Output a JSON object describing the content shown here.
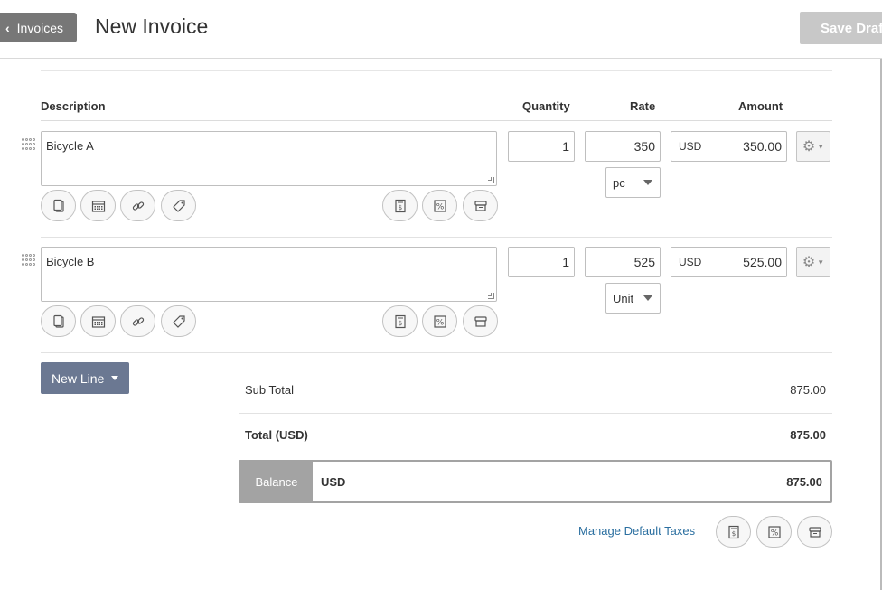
{
  "header": {
    "back_label": "Invoices",
    "title": "New Invoice",
    "save_label": "Save Draft"
  },
  "table": {
    "columns": [
      "Description",
      "Quantity",
      "Rate",
      "Amount"
    ],
    "rows": [
      {
        "description": "Bicycle A",
        "quantity": "1",
        "rate": "350",
        "currency": "USD",
        "amount": "350.00",
        "unit": "pc"
      },
      {
        "description": "Bicycle B",
        "quantity": "1",
        "rate": "525",
        "currency": "USD",
        "amount": "525.00",
        "unit": "Unit"
      }
    ],
    "row_icons": [
      "copy-icon",
      "calendar-icon",
      "link-icon",
      "tag-icon",
      "tax-icon",
      "discount-icon",
      "archive-icon"
    ]
  },
  "actions": {
    "new_line_label": "New Line"
  },
  "totals": {
    "subtotal_label": "Sub Total",
    "subtotal_value": "875.00",
    "total_label": "Total (USD)",
    "total_value": "875.00",
    "balance_label": "Balance",
    "balance_currency": "USD",
    "balance_value": "875.00"
  },
  "footer": {
    "manage_taxes_label": "Manage Default Taxes",
    "icons": [
      "tax-icon",
      "discount-icon",
      "archive-icon"
    ]
  },
  "colors": {
    "back_button": "#777777",
    "save_button": "#c8c8c8",
    "new_line_button": "#6b7892",
    "link": "#2b6fa0",
    "balance_label_bg": "#a3a3a3"
  }
}
